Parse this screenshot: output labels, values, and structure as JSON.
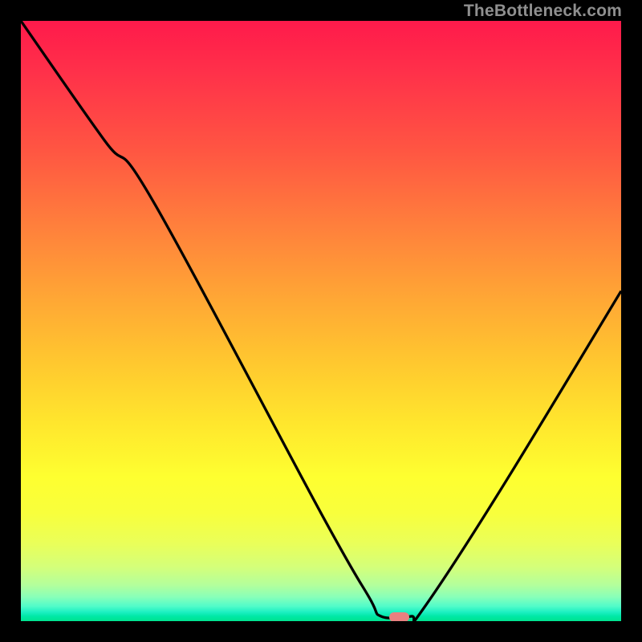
{
  "watermark": "TheBottleneck.com",
  "marker": {
    "x_pct": 63,
    "y_pct": 100
  },
  "chart_data": {
    "type": "line",
    "title": "",
    "xlabel": "",
    "ylabel": "",
    "xlim": [
      0,
      100
    ],
    "ylim": [
      0,
      100
    ],
    "series": [
      {
        "name": "bottleneck-curve",
        "points": [
          {
            "x": 0,
            "y": 100
          },
          {
            "x": 14,
            "y": 80
          },
          {
            "x": 22,
            "y": 70
          },
          {
            "x": 50,
            "y": 18
          },
          {
            "x": 58,
            "y": 4
          },
          {
            "x": 60,
            "y": 0.8
          },
          {
            "x": 65,
            "y": 0.8
          },
          {
            "x": 67,
            "y": 2
          },
          {
            "x": 80,
            "y": 22
          },
          {
            "x": 100,
            "y": 55
          }
        ]
      }
    ],
    "annotations": [
      {
        "type": "marker",
        "shape": "rounded-pill",
        "color": "#e98080",
        "x": 63,
        "y": 0
      }
    ],
    "gradient_background": {
      "top": "#ff1a4b",
      "bottom": "#00e38f"
    }
  }
}
